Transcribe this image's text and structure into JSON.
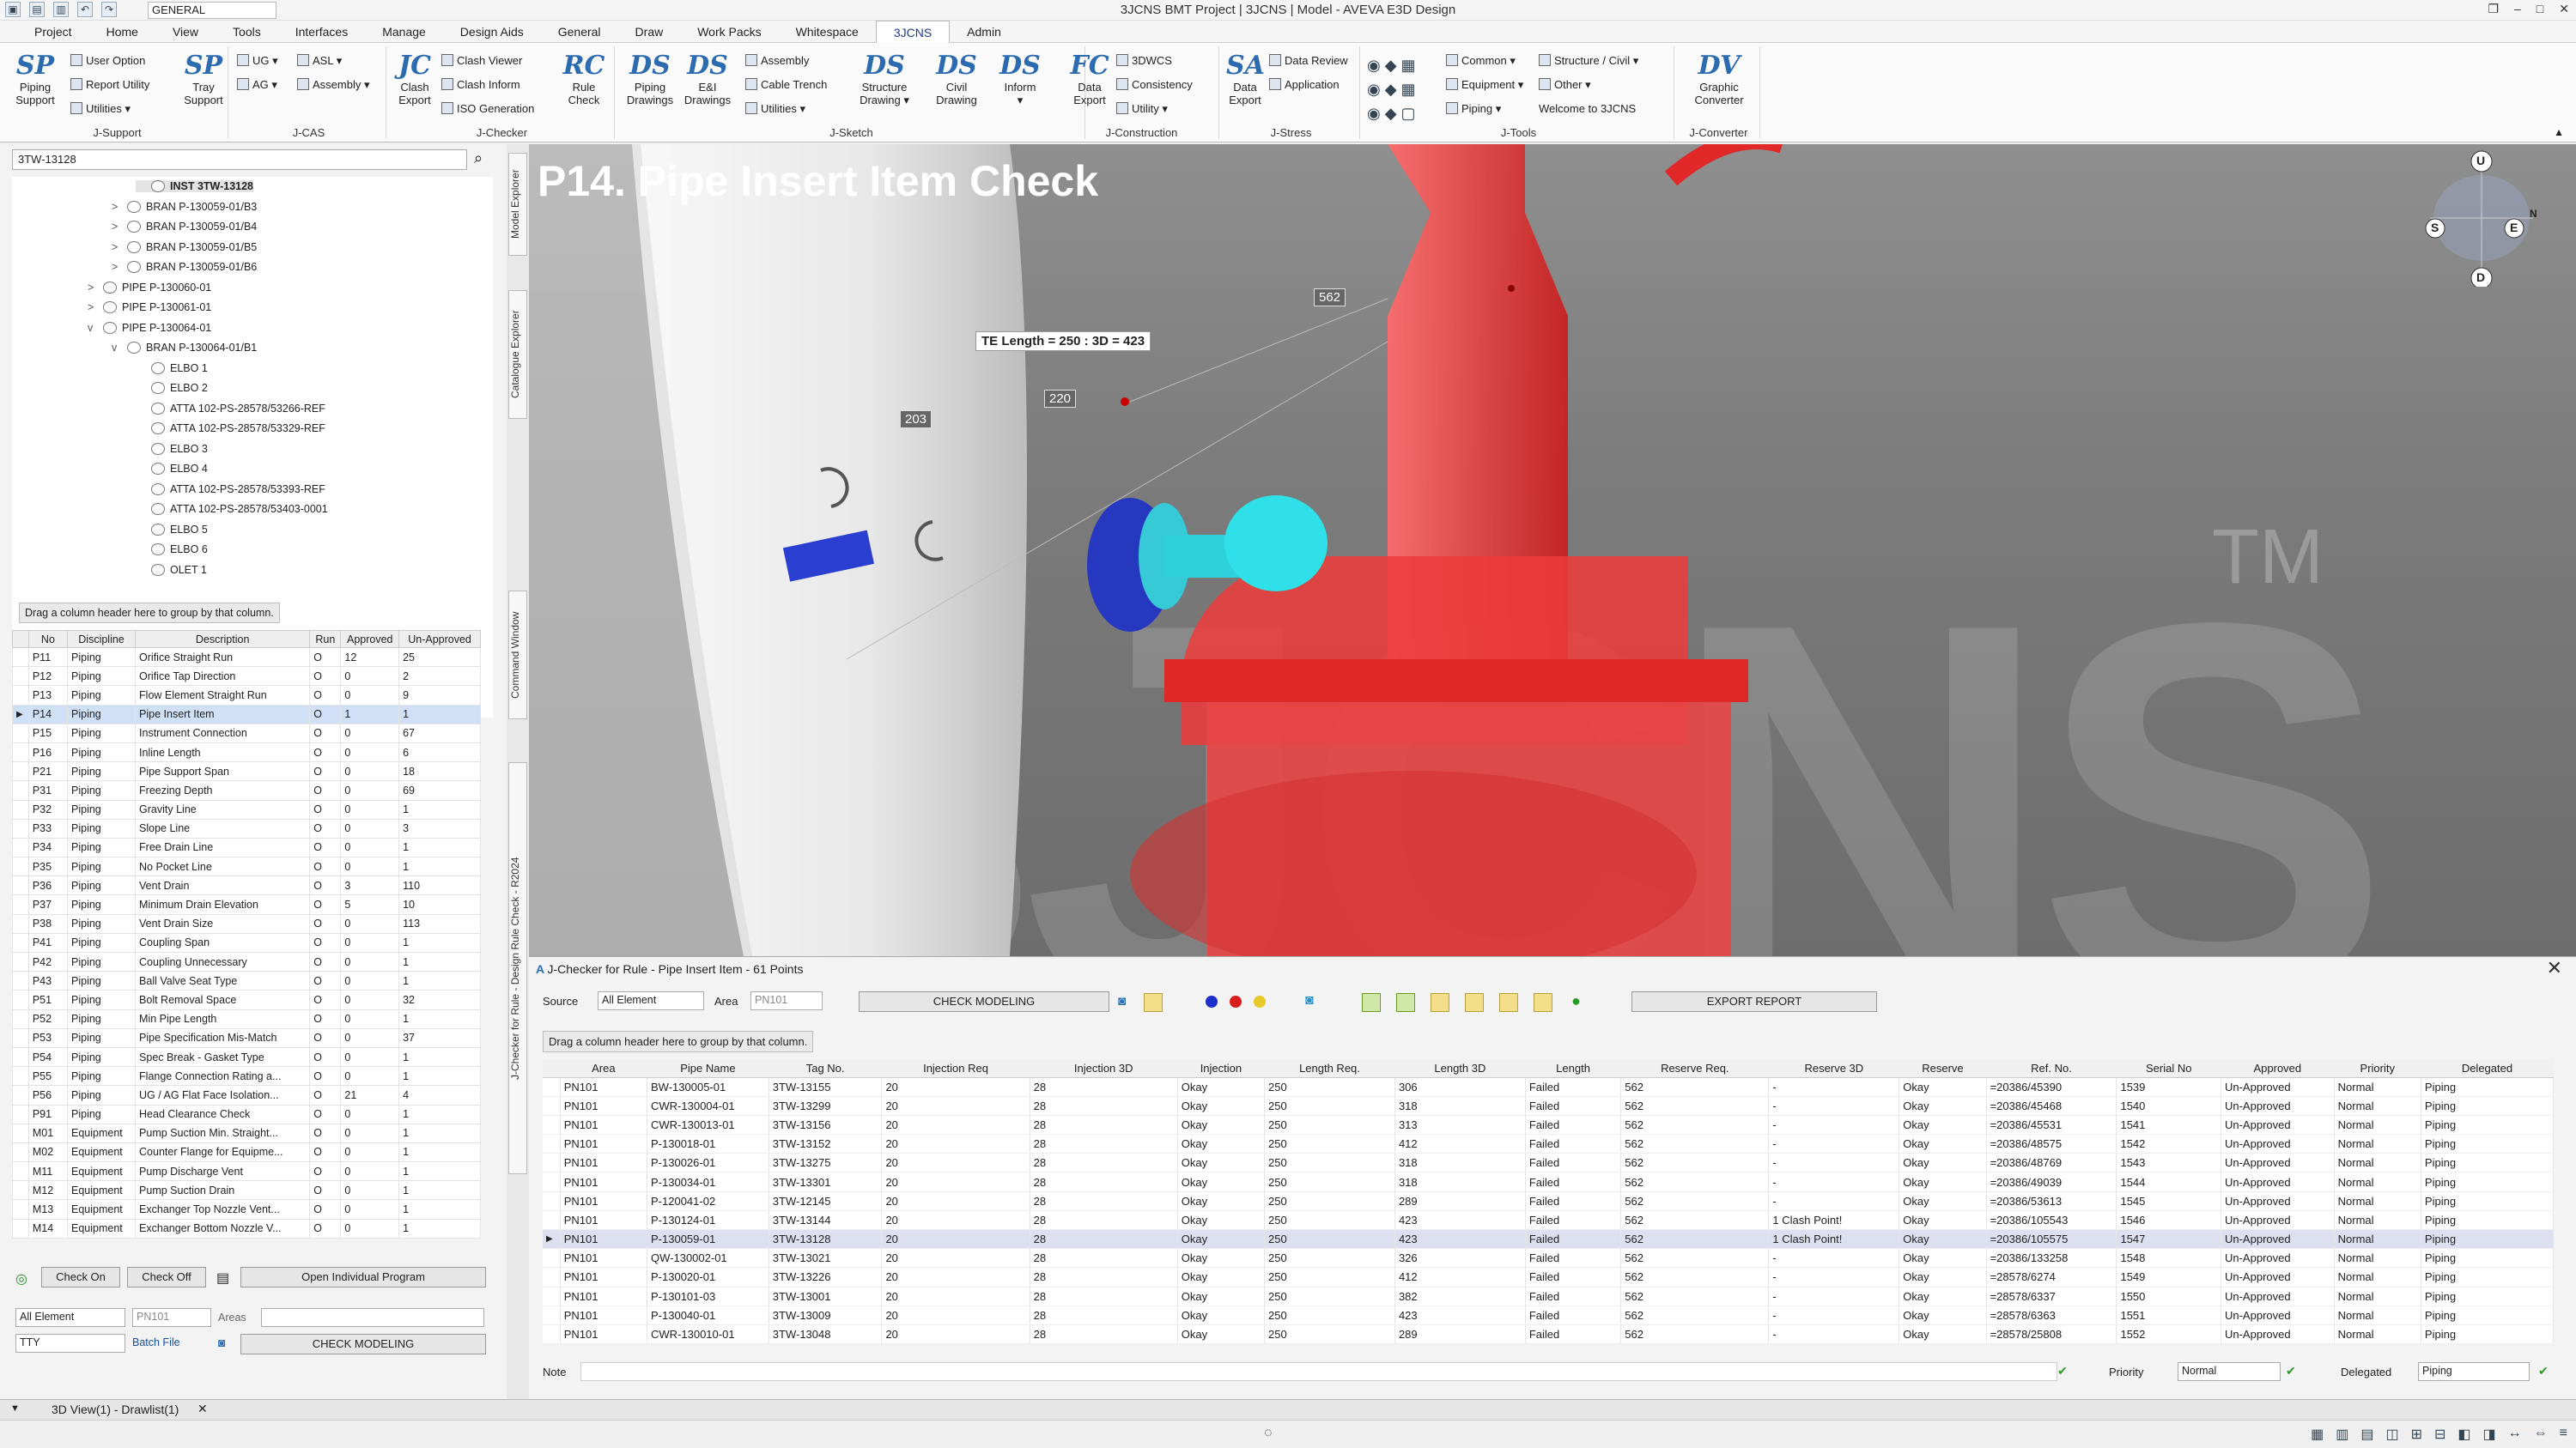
{
  "window": {
    "title": "3JCNS BMT Project | 3JCNS | Model - AVEVA E3D Design",
    "project": "GENERAL"
  },
  "menu": [
    "Project",
    "Home",
    "View",
    "Tools",
    "Interfaces",
    "Manage",
    "Design Aids",
    "General",
    "Draw",
    "Work Packs",
    "Whitespace",
    "3JCNS",
    "Admin"
  ],
  "ribbon": {
    "jsupport": {
      "name": "J-Support",
      "piping": "Piping\nSupport",
      "user_option": "User Option",
      "report_utility": "Report Utility",
      "utilities": "Utilities ▾",
      "tray": "Tray\nSupport"
    },
    "jcas": {
      "name": "J-CAS",
      "ug": "UG ▾",
      "asl": "ASL ▾",
      "ag": "AG ▾",
      "assembly": "Assembly ▾"
    },
    "jchecker": {
      "name": "J-Checker",
      "clash_export": "Clash\nExport",
      "clash_viewer": "Clash Viewer",
      "clash_inform": "Clash Inform",
      "iso_generation": "ISO Generation",
      "rule_check": "Rule\nCheck"
    },
    "jsketch": {
      "name": "J-Sketch",
      "piping_drawings": "Piping\nDrawings",
      "ei_drawings": "E&I\nDrawings",
      "assembly": "Assembly",
      "cable_trench": "Cable Trench",
      "utilities": "Utilities ▾",
      "structure_drawing": "Structure\nDrawing ▾",
      "civil_drawing": "Civil\nDrawing",
      "inform": "Inform\n▾"
    },
    "jconstruction": {
      "name": "J-Construction",
      "data_export": "Data\nExport",
      "dwcs": "3DWCS",
      "consistency": "Consistency",
      "utility": "Utility ▾"
    },
    "jstress": {
      "name": "J-Stress",
      "data_export": "Data\nExport",
      "data_review": "Data Review",
      "application": "Application"
    },
    "jtools": {
      "name": "J-Tools",
      "common": "Common ▾",
      "equipment": "Equipment ▾",
      "piping": "Piping ▾",
      "structure_civil": "Structure / Civil ▾",
      "other": "Other ▾",
      "welcome": "Welcome to 3JCNS"
    },
    "jconverter": {
      "name": "J-Converter",
      "graphic_converter": "Graphic\nConverter"
    }
  },
  "explorer": {
    "search": "3TW-13128",
    "nodes": [
      {
        "label": "INST 3TW-13128",
        "level": 3,
        "bold": true
      },
      {
        "label": "BRAN P-130059-01/B3",
        "level": 2,
        "tw": ">"
      },
      {
        "label": "BRAN P-130059-01/B4",
        "level": 2,
        "tw": ">"
      },
      {
        "label": "BRAN P-130059-01/B5",
        "level": 2,
        "tw": ">"
      },
      {
        "label": "BRAN P-130059-01/B6",
        "level": 2,
        "tw": ">"
      },
      {
        "label": "PIPE P-130060-01",
        "level": 1,
        "tw": ">"
      },
      {
        "label": "PIPE P-130061-01",
        "level": 1,
        "tw": ">"
      },
      {
        "label": "PIPE P-130064-01",
        "level": 1,
        "tw": "v"
      },
      {
        "label": "BRAN P-130064-01/B1",
        "level": 2,
        "tw": "v"
      },
      {
        "label": "ELBO 1",
        "level": 3
      },
      {
        "label": "ELBO 2",
        "level": 3
      },
      {
        "label": "ATTA 102-PS-28578/53266-REF",
        "level": 3
      },
      {
        "label": "ATTA 102-PS-28578/53329-REF",
        "level": 3
      },
      {
        "label": "ELBO 3",
        "level": 3
      },
      {
        "label": "ELBO 4",
        "level": 3
      },
      {
        "label": "ATTA 102-PS-28578/53393-REF",
        "level": 3
      },
      {
        "label": "ATTA 102-PS-28578/53403-0001",
        "level": 3
      },
      {
        "label": "ELBO 5",
        "level": 3
      },
      {
        "label": "ELBO 6",
        "level": 3
      },
      {
        "label": "OLET 1",
        "level": 3
      }
    ]
  },
  "side_tabs": {
    "model": "Model Explorer",
    "catalogue": "Catalogue Explorer",
    "command": "Command Window",
    "jchecker": "J-Checker for Rule - Design Rule Check - R2024"
  },
  "rules": {
    "group_hint": "Drag a column header here to group by that column.",
    "columns": [
      "No",
      "Discipline",
      "Description",
      "Run",
      "Approved",
      "Un-Approved"
    ],
    "rows": [
      [
        "P11",
        "Piping",
        "Orifice Straight Run",
        "O",
        "12",
        "25"
      ],
      [
        "P12",
        "Piping",
        "Orifice Tap Direction",
        "O",
        "0",
        "2"
      ],
      [
        "P13",
        "Piping",
        "Flow Element Straight Run",
        "O",
        "0",
        "9"
      ],
      [
        "P14",
        "Piping",
        "Pipe Insert Item",
        "O",
        "1",
        "1"
      ],
      [
        "P15",
        "Piping",
        "Instrument Connection",
        "O",
        "0",
        "67"
      ],
      [
        "P16",
        "Piping",
        "Inline Length",
        "O",
        "0",
        "6"
      ],
      [
        "P21",
        "Piping",
        "Pipe Support Span",
        "O",
        "0",
        "18"
      ],
      [
        "P31",
        "Piping",
        "Freezing Depth",
        "O",
        "0",
        "69"
      ],
      [
        "P32",
        "Piping",
        "Gravity Line",
        "O",
        "0",
        "1"
      ],
      [
        "P33",
        "Piping",
        "Slope Line",
        "O",
        "0",
        "3"
      ],
      [
        "P34",
        "Piping",
        "Free Drain Line",
        "O",
        "0",
        "1"
      ],
      [
        "P35",
        "Piping",
        "No Pocket Line",
        "O",
        "0",
        "1"
      ],
      [
        "P36",
        "Piping",
        "Vent Drain",
        "O",
        "3",
        "110"
      ],
      [
        "P37",
        "Piping",
        "Minimum Drain Elevation",
        "O",
        "5",
        "10"
      ],
      [
        "P38",
        "Piping",
        "Vent Drain Size",
        "O",
        "0",
        "113"
      ],
      [
        "P41",
        "Piping",
        "Coupling Span",
        "O",
        "0",
        "1"
      ],
      [
        "P42",
        "Piping",
        "Coupling Unnecessary",
        "O",
        "0",
        "1"
      ],
      [
        "P43",
        "Piping",
        "Ball Valve Seat Type",
        "O",
        "0",
        "1"
      ],
      [
        "P51",
        "Piping",
        "Bolt Removal Space",
        "O",
        "0",
        "32"
      ],
      [
        "P52",
        "Piping",
        "Min Pipe Length",
        "O",
        "0",
        "1"
      ],
      [
        "P53",
        "Piping",
        "Pipe Specification Mis-Match",
        "O",
        "0",
        "37"
      ],
      [
        "P54",
        "Piping",
        "Spec Break - Gasket Type",
        "O",
        "0",
        "1"
      ],
      [
        "P55",
        "Piping",
        "Flange Connection Rating a...",
        "O",
        "0",
        "1"
      ],
      [
        "P56",
        "Piping",
        "UG / AG Flat Face Isolation...",
        "O",
        "21",
        "4"
      ],
      [
        "P91",
        "Piping",
        "Head Clearance Check",
        "O",
        "0",
        "1"
      ],
      [
        "M01",
        "Equipment",
        "Pump Suction Min. Straight...",
        "O",
        "0",
        "1"
      ],
      [
        "M02",
        "Equipment",
        "Counter Flange for Equipme...",
        "O",
        "0",
        "1"
      ],
      [
        "M11",
        "Equipment",
        "Pump Discharge Vent",
        "O",
        "0",
        "1"
      ],
      [
        "M12",
        "Equipment",
        "Pump Suction Drain",
        "O",
        "0",
        "1"
      ],
      [
        "M13",
        "Equipment",
        "Exchanger Top Nozzle Vent...",
        "O",
        "0",
        "1"
      ],
      [
        "M14",
        "Equipment",
        "Exchanger Bottom Nozzle V...",
        "O",
        "0",
        "1"
      ]
    ],
    "check_on": "Check On",
    "check_off": "Check Off",
    "open_program": "Open Individual Program",
    "filter_element": "All Element",
    "filter_pipe": "PN101",
    "areas_label": "Areas",
    "type": "TTY",
    "batch_file": "Batch File",
    "check_modeling": "CHECK MODELING"
  },
  "viewport": {
    "title": "P14. Pipe Insert Item Check",
    "watermark": "3JCNS",
    "tm": "TM",
    "te_label": "TE Length = 250 : 3D = 423",
    "dim1": "562",
    "dim2": "220",
    "dim3": "203",
    "compass": [
      "U",
      "S",
      "E",
      "N",
      "D"
    ]
  },
  "jchecker": {
    "title": "J-Checker for Rule - Pipe Insert Item - 61 Points",
    "source_label": "Source",
    "source_value": "All Element",
    "area_label": "Area",
    "area_value": "PN101",
    "check_modeling": "CHECK MODELING",
    "export_report": "EXPORT REPORT",
    "group_hint": "Drag a column header here to group by that column.",
    "columns": [
      "Area",
      "Pipe Name",
      "Tag No.",
      "Injection Req",
      "Injection 3D",
      "Injection",
      "Length Req.",
      "Length 3D",
      "Length",
      "Reserve Req.",
      "Reserve 3D",
      "Reserve",
      "Ref. No.",
      "Serial No",
      "Approved",
      "Priority",
      "Delegated"
    ],
    "rows": [
      [
        "PN101",
        "BW-130005-01",
        "3TW-13155",
        "20",
        "28",
        "Okay",
        "250",
        "306",
        "Failed",
        "562",
        "-",
        "Okay",
        "=20386/45390",
        "1539",
        "Un-Approved",
        "Normal",
        "Piping"
      ],
      [
        "PN101",
        "CWR-130004-01",
        "3TW-13299",
        "20",
        "28",
        "Okay",
        "250",
        "318",
        "Failed",
        "562",
        "-",
        "Okay",
        "=20386/45468",
        "1540",
        "Un-Approved",
        "Normal",
        "Piping"
      ],
      [
        "PN101",
        "CWR-130013-01",
        "3TW-13156",
        "20",
        "28",
        "Okay",
        "250",
        "313",
        "Failed",
        "562",
        "-",
        "Okay",
        "=20386/45531",
        "1541",
        "Un-Approved",
        "Normal",
        "Piping"
      ],
      [
        "PN101",
        "P-130018-01",
        "3TW-13152",
        "20",
        "28",
        "Okay",
        "250",
        "412",
        "Failed",
        "562",
        "-",
        "Okay",
        "=20386/48575",
        "1542",
        "Un-Approved",
        "Normal",
        "Piping"
      ],
      [
        "PN101",
        "P-130026-01",
        "3TW-13275",
        "20",
        "28",
        "Okay",
        "250",
        "318",
        "Failed",
        "562",
        "-",
        "Okay",
        "=20386/48769",
        "1543",
        "Un-Approved",
        "Normal",
        "Piping"
      ],
      [
        "PN101",
        "P-130034-01",
        "3TW-13301",
        "20",
        "28",
        "Okay",
        "250",
        "318",
        "Failed",
        "562",
        "-",
        "Okay",
        "=20386/49039",
        "1544",
        "Un-Approved",
        "Normal",
        "Piping"
      ],
      [
        "PN101",
        "P-120041-02",
        "3TW-12145",
        "20",
        "28",
        "Okay",
        "250",
        "289",
        "Failed",
        "562",
        "-",
        "Okay",
        "=20386/53613",
        "1545",
        "Un-Approved",
        "Normal",
        "Piping"
      ],
      [
        "PN101",
        "P-130124-01",
        "3TW-13144",
        "20",
        "28",
        "Okay",
        "250",
        "423",
        "Failed",
        "562",
        "1 Clash Point!",
        "Okay",
        "=20386/105543",
        "1546",
        "Un-Approved",
        "Normal",
        "Piping"
      ],
      [
        "PN101",
        "P-130059-01",
        "3TW-13128",
        "20",
        "28",
        "Okay",
        "250",
        "423",
        "Failed",
        "562",
        "1 Clash Point!",
        "Okay",
        "=20386/105575",
        "1547",
        "Un-Approved",
        "Normal",
        "Piping"
      ],
      [
        "PN101",
        "QW-130002-01",
        "3TW-13021",
        "20",
        "28",
        "Okay",
        "250",
        "326",
        "Failed",
        "562",
        "-",
        "Okay",
        "=20386/133258",
        "1548",
        "Un-Approved",
        "Normal",
        "Piping"
      ],
      [
        "PN101",
        "P-130020-01",
        "3TW-13226",
        "20",
        "28",
        "Okay",
        "250",
        "412",
        "Failed",
        "562",
        "-",
        "Okay",
        "=28578/6274",
        "1549",
        "Un-Approved",
        "Normal",
        "Piping"
      ],
      [
        "PN101",
        "P-130101-03",
        "3TW-13001",
        "20",
        "28",
        "Okay",
        "250",
        "382",
        "Failed",
        "562",
        "-",
        "Okay",
        "=28578/6337",
        "1550",
        "Un-Approved",
        "Normal",
        "Piping"
      ],
      [
        "PN101",
        "P-130040-01",
        "3TW-13009",
        "20",
        "28",
        "Okay",
        "250",
        "423",
        "Failed",
        "562",
        "-",
        "Okay",
        "=28578/6363",
        "1551",
        "Un-Approved",
        "Normal",
        "Piping"
      ],
      [
        "PN101",
        "CWR-130010-01",
        "3TW-13048",
        "20",
        "28",
        "Okay",
        "250",
        "289",
        "Failed",
        "562",
        "-",
        "Okay",
        "=28578/25808",
        "1552",
        "Un-Approved",
        "Normal",
        "Piping"
      ]
    ],
    "note_label": "Note",
    "priority_label": "Priority",
    "priority_value": "Normal",
    "delegated_label": "Delegated",
    "delegated_value": "Piping"
  },
  "doc_tab": "3D View(1) - Drawlist(1)"
}
